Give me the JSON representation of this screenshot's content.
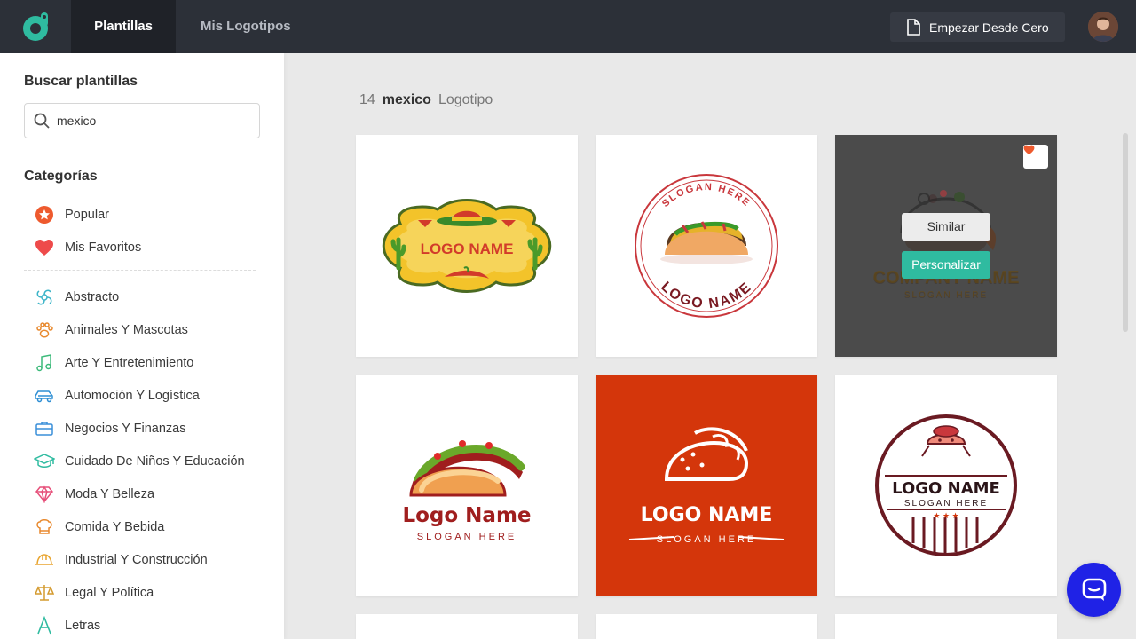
{
  "nav": {
    "tabs": [
      {
        "label": "Plantillas",
        "active": true
      },
      {
        "label": "Mis Logotipos",
        "active": false
      }
    ],
    "start_button": "Empezar Desde Cero"
  },
  "sidebar": {
    "search_title": "Buscar plantillas",
    "search_value": "mexico",
    "categories_title": "Categorías",
    "pinned": [
      {
        "label": "Popular",
        "icon": "star-icon"
      },
      {
        "label": "Mis Favoritos",
        "icon": "heart-icon"
      }
    ],
    "categories": [
      {
        "label": "Abstracto",
        "icon": "abstract-icon"
      },
      {
        "label": "Animales Y Mascotas",
        "icon": "paw-icon"
      },
      {
        "label": "Arte Y Entretenimiento",
        "icon": "music-note-icon"
      },
      {
        "label": "Automoción Y Logística",
        "icon": "car-icon"
      },
      {
        "label": "Negocios Y Finanzas",
        "icon": "briefcase-icon"
      },
      {
        "label": "Cuidado De Niños Y Educación",
        "icon": "graduation-cap-icon"
      },
      {
        "label": "Moda Y Belleza",
        "icon": "diamond-icon"
      },
      {
        "label": "Comida Y Bebida",
        "icon": "chef-hat-icon"
      },
      {
        "label": "Industrial Y Construcción",
        "icon": "hard-hat-icon"
      },
      {
        "label": "Legal Y Política",
        "icon": "scales-icon"
      },
      {
        "label": "Letras",
        "icon": "letter-a-icon"
      }
    ]
  },
  "results": {
    "count": "14",
    "term": "mexico",
    "type": "Logotipo"
  },
  "cards": [
    {
      "main_text": "LOGO NAME",
      "sub_text": ""
    },
    {
      "main_text": "LOGO NAME",
      "sub_text": "SLOGAN HERE"
    },
    {
      "main_text": "COMPANY NAME",
      "sub_text": "SLOGAN HERE",
      "similar_label": "Similar",
      "customize_label": "Personalizar"
    },
    {
      "main_text": "Logo Name",
      "sub_text": "SLOGAN HERE"
    },
    {
      "main_text": "LOGO NAME",
      "sub_text": "SLOGAN HERE"
    },
    {
      "main_text": "LOGO NAME",
      "sub_text": "SLOGAN HERE"
    }
  ],
  "colors": {
    "topbar": "#2c3038",
    "accent_teal": "#2fbba0",
    "taco_red": "#d4360b",
    "chat_blue": "#1f22e6",
    "heart": "#ee4b2b"
  }
}
